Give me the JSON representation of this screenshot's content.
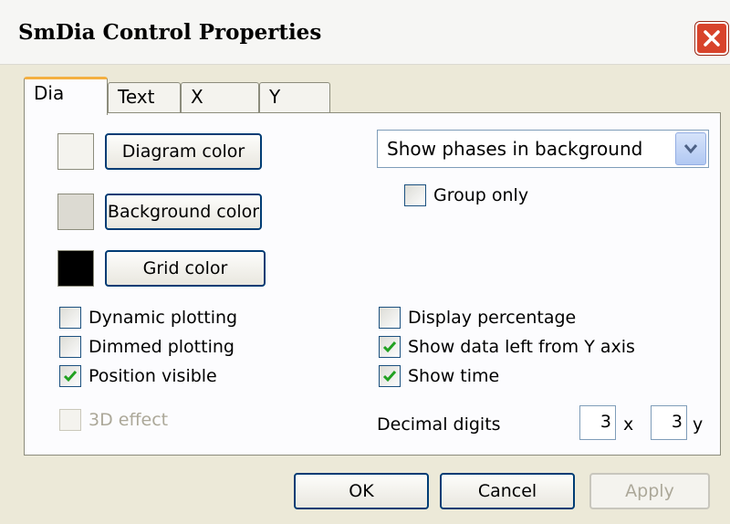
{
  "window": {
    "title": "SmDia Control Properties"
  },
  "tabs": [
    {
      "label": "Dia",
      "active": true
    },
    {
      "label": "Text",
      "active": false
    },
    {
      "label": "X",
      "active": false
    },
    {
      "label": "Y",
      "active": false
    }
  ],
  "colors": {
    "diagram": "#f4f3ee",
    "background": "#dcdad2",
    "grid": "#000000"
  },
  "buttons": {
    "diagram_color": "Diagram color",
    "background_color": "Background color",
    "grid_color": "Grid color"
  },
  "dropdown": {
    "selected": "Show phases in background"
  },
  "checkboxes": {
    "group_only": {
      "label": "Group only",
      "checked": false
    },
    "dynamic_plotting": {
      "label": "Dynamic plotting",
      "checked": false
    },
    "dimmed_plotting": {
      "label": "Dimmed plotting",
      "checked": false
    },
    "position_visible": {
      "label": "Position visible",
      "checked": true
    },
    "effect_3d": {
      "label": "3D effect",
      "checked": false,
      "disabled": true
    },
    "display_percentage": {
      "label": "Display percentage",
      "checked": false
    },
    "show_data_left": {
      "label": "Show data left from Y axis",
      "checked": true
    },
    "show_time": {
      "label": "Show time",
      "checked": true
    }
  },
  "decimal": {
    "label": "Decimal digits",
    "x_value": "3",
    "x_label": "x",
    "y_value": "3",
    "y_label": "y"
  },
  "footer": {
    "ok": "OK",
    "cancel": "Cancel",
    "apply": "Apply"
  }
}
